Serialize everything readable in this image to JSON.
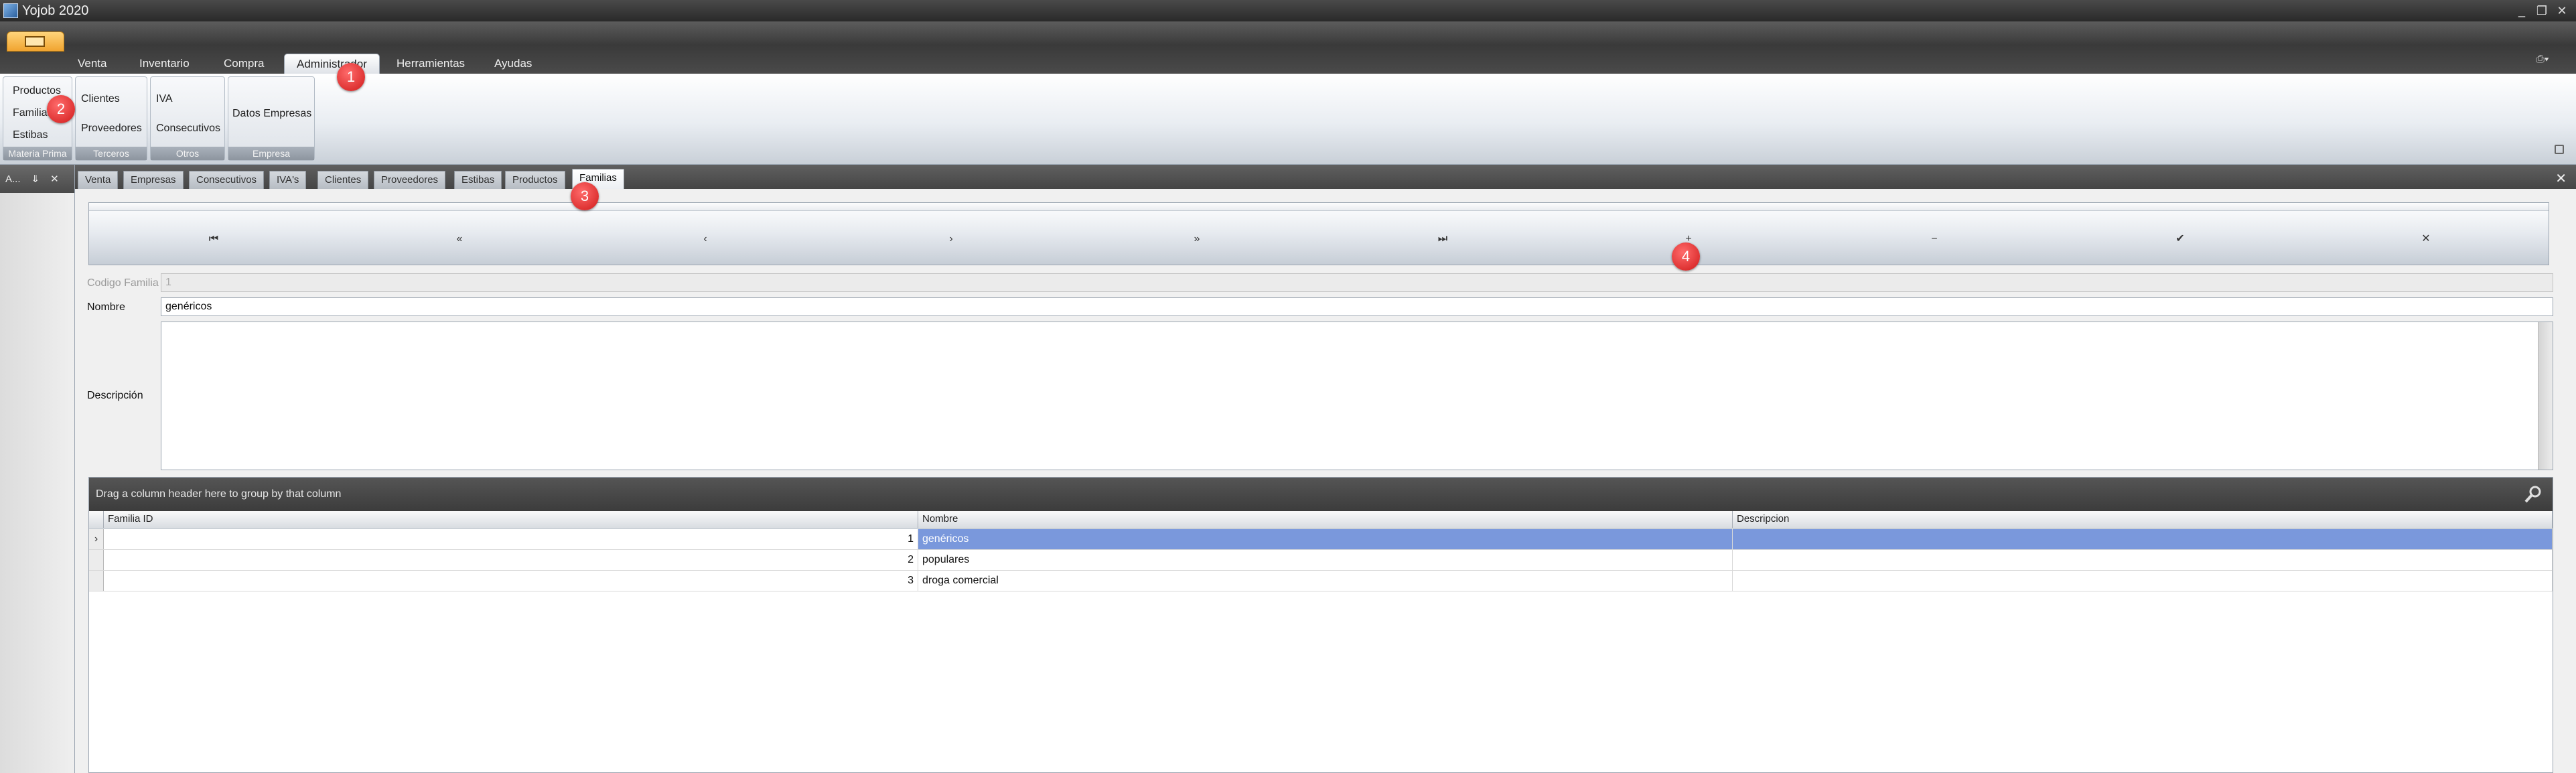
{
  "window": {
    "title": "Yojob 2020",
    "controls": [
      "_",
      "❐",
      "✕"
    ]
  },
  "menu": {
    "tabs": [
      {
        "label": "Venta"
      },
      {
        "label": "Inventario"
      },
      {
        "label": "Compra"
      },
      {
        "label": "Administrador",
        "active": true
      },
      {
        "label": "Herramientas"
      },
      {
        "label": "Ayudas"
      }
    ]
  },
  "ribbon": {
    "groups": [
      {
        "caption": "Materia Prima",
        "items": [
          "Productos",
          "Familias",
          "Estibas"
        ]
      },
      {
        "caption": "Terceros",
        "items": [
          "Clientes",
          "Proveedores"
        ]
      },
      {
        "caption": "Otros",
        "items": [
          "IVA",
          "Consecutivos"
        ]
      },
      {
        "caption": "Empresa",
        "items": [
          "Datos Empresas"
        ]
      }
    ]
  },
  "dock": {
    "title": "A...",
    "pin": "⇓",
    "close": "✕"
  },
  "doc_tabs": [
    "Venta",
    "Empresas",
    "Consecutivos",
    "IVA's",
    "Clientes",
    "Proveedores",
    "Estibas",
    "Productos",
    "Familias"
  ],
  "active_doc_tab": "Familias",
  "navigator": [
    "⏮",
    "«",
    "‹",
    "›",
    "»",
    "⏭",
    "+",
    "−",
    "✔",
    "✕"
  ],
  "form": {
    "codigo_label": "Codigo Familia",
    "codigo_value": "1",
    "nombre_label": "Nombre",
    "nombre_value": "genéricos",
    "descripcion_label": "Descripción",
    "descripcion_value": ""
  },
  "grid": {
    "group_panel_text": "Drag a column header here to group by that column",
    "columns": [
      "Familia ID",
      "Nombre",
      "Descripcion"
    ],
    "rows": [
      {
        "id": "1",
        "nombre": "genéricos",
        "descripcion": ""
      },
      {
        "id": "2",
        "nombre": "populares",
        "descripcion": ""
      },
      {
        "id": "3",
        "nombre": "droga comercial",
        "descripcion": ""
      }
    ],
    "row_indicator": "›"
  },
  "callouts": [
    "1",
    "2",
    "3",
    "4"
  ],
  "colors": {
    "selected_row": "#7a98dc",
    "callout": "#d01a1a",
    "app_button": "#f0a430"
  }
}
